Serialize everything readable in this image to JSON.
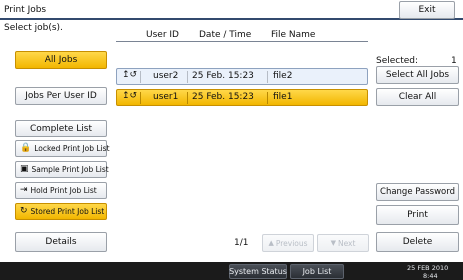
{
  "header": {
    "title": "Print Jobs",
    "exit_label": "Exit"
  },
  "left_panel": {
    "select_label": "Select job(s).",
    "buttons": {
      "all_jobs": "All Jobs",
      "jobs_per_user": "Jobs Per User ID",
      "complete_list": "Complete List",
      "locked": "Locked Print Job List",
      "sample": "Sample Print Job List",
      "hold": "Hold Print Job List",
      "stored": "Stored Print Job List",
      "details": "Details"
    }
  },
  "table": {
    "columns": [
      "User ID",
      "Date / Time",
      "File Name"
    ],
    "rows": [
      {
        "user": "user2",
        "datetime": "25 Feb. 15:23",
        "file": "file2",
        "selected": false
      },
      {
        "user": "user1",
        "datetime": "25 Feb. 15:23",
        "file": "file1",
        "selected": true
      }
    ],
    "page": "1/1",
    "prev_label": "Previous",
    "next_label": "Next"
  },
  "right_panel": {
    "selected_label": "Selected:",
    "selected_count": "1",
    "select_all": "Select All Jobs",
    "clear_all": "Clear All",
    "change_password": "Change Password",
    "print": "Print",
    "delete": "Delete"
  },
  "footer": {
    "system_status": "System Status",
    "job_list": "Job List",
    "date": "25 FEB 2010",
    "time": "8:44"
  },
  "colors": {
    "selected_fill": "#f2b600",
    "header_line": "#334a6e",
    "footer_bg": "#1b1b1b",
    "row_fill": "#eaf1fb"
  }
}
